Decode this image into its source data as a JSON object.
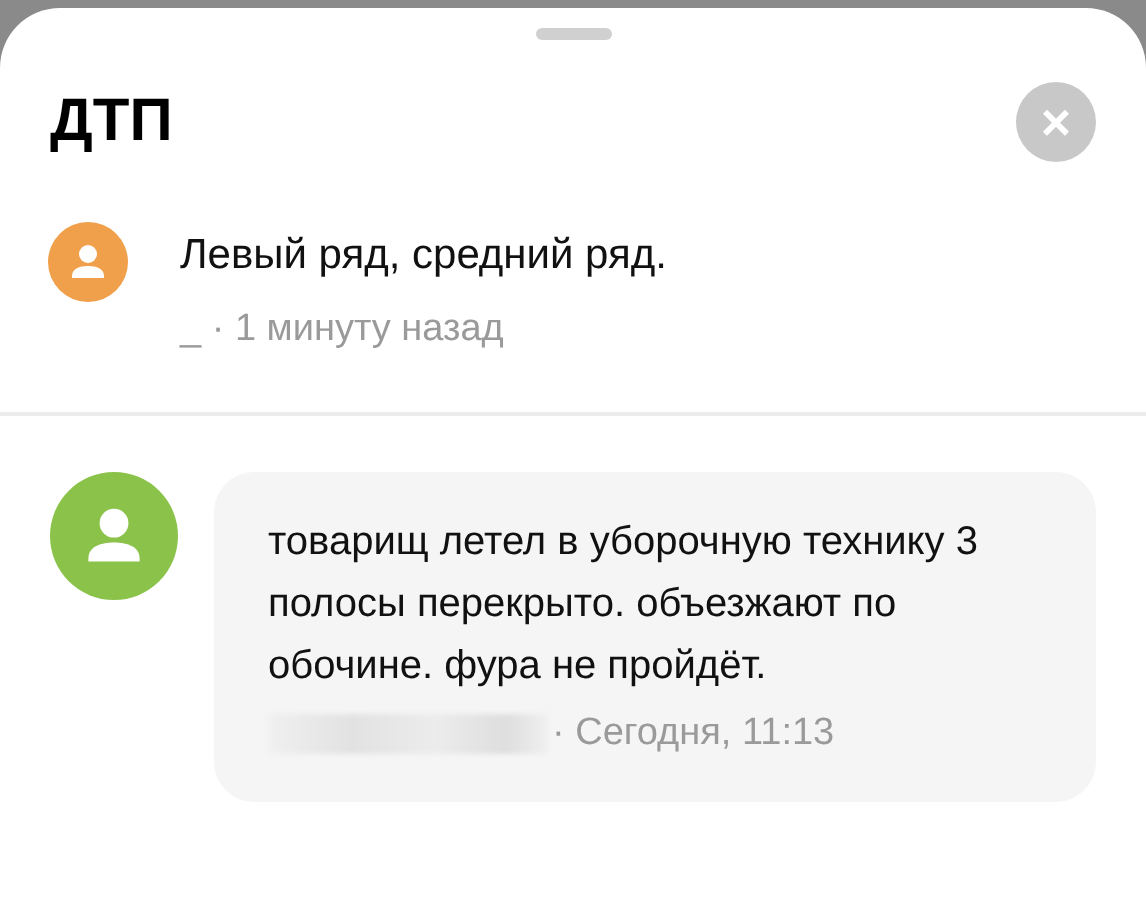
{
  "sheet": {
    "title": "ДТП",
    "close_label": "×"
  },
  "comments": [
    {
      "kind": "plain",
      "color": "#f0a04b",
      "text": "Левый ряд, средний ряд.",
      "author_redacted": false,
      "meta": "_ · 1 минуту назад"
    },
    {
      "kind": "bubble",
      "color": "#8bc34a",
      "text": "товарищ летел в уборочную технику 3 полосы перекрыто. объезжают по обочине. фура не пройдёт.",
      "author_redacted": true,
      "meta": "· Сегодня, 11:13"
    }
  ]
}
